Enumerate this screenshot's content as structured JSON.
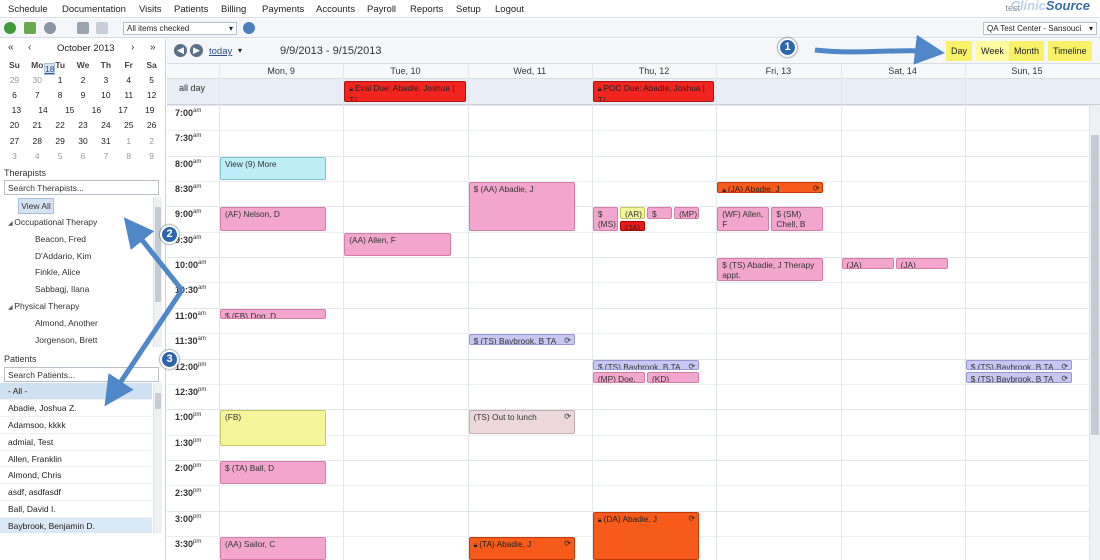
{
  "menu": [
    "Schedule",
    "Documentation",
    "Visits",
    "Patients",
    "Billing",
    "Payments",
    "Accounts",
    "Payroll",
    "Reports",
    "Setup",
    "Logout"
  ],
  "brand": {
    "user": "test",
    "logo_a": "Clinic",
    "logo_b": "Source"
  },
  "toolbar": {
    "filter_select": "All items checked",
    "center_select": "QA Test Center - Sansouci"
  },
  "mini_calendar": {
    "title": "October 2013",
    "nav": [
      "«",
      "‹",
      "›",
      "»"
    ],
    "weekdays": [
      "Su",
      "Mo",
      "Tu",
      "We",
      "Th",
      "Fr",
      "Sa"
    ],
    "weeks": [
      [
        "29",
        "30",
        "1",
        "2",
        "3",
        "4",
        "5"
      ],
      [
        "6",
        "7",
        "8",
        "9",
        "10",
        "11",
        "12"
      ],
      [
        "13",
        "14",
        "15",
        "16",
        "17",
        "18",
        "19"
      ],
      [
        "20",
        "21",
        "22",
        "23",
        "24",
        "25",
        "26"
      ],
      [
        "27",
        "28",
        "29",
        "30",
        "31",
        "1",
        "2"
      ],
      [
        "3",
        "4",
        "5",
        "6",
        "7",
        "8",
        "9"
      ]
    ]
  },
  "therapists": {
    "label": "Therapists",
    "search_placeholder": "Search Therapists...",
    "view_all": "View All",
    "groups": [
      {
        "name": "Occupational Therapy",
        "members": [
          "Beacon, Fred",
          "D'Addario, Kim",
          "Finkle, Alice",
          "Sabbagj, Ilana"
        ]
      },
      {
        "name": "Physical Therapy",
        "members": [
          "Almond, Another",
          "Jorgenson, Brett"
        ]
      }
    ]
  },
  "patients": {
    "label": "Patients",
    "search_placeholder": "Search Patients...",
    "items": [
      "- All -",
      "Abadie, Joshua Z.",
      "Adamsoo, kkkk",
      "admial, Test",
      "Allen, Franklin",
      "Almond, Chris",
      "asdf, asdfasdf",
      "Ball, David I.",
      "Baybrook, Benjamin D."
    ]
  },
  "calendar": {
    "today_label": "today",
    "range": "9/9/2013 - 9/15/2013",
    "views": [
      "Day",
      "Week",
      "Month",
      "Timeline"
    ],
    "days": [
      "Mon, 9",
      "Tue, 10",
      "Wed, 11",
      "Thu, 12",
      "Fri, 13",
      "Sat, 14",
      "Sun, 15"
    ],
    "all_day_label": "all day",
    "times": [
      {
        "h": "7:00",
        "ap": "am"
      },
      {
        "h": "7:30",
        "ap": "am"
      },
      {
        "h": "8:00",
        "ap": "am"
      },
      {
        "h": "8:30",
        "ap": "am"
      },
      {
        "h": "9:00",
        "ap": "am"
      },
      {
        "h": "9:30",
        "ap": "am"
      },
      {
        "h": "10:00",
        "ap": "am"
      },
      {
        "h": "10:30",
        "ap": "am"
      },
      {
        "h": "11:00",
        "ap": "am"
      },
      {
        "h": "11:30",
        "ap": "am"
      },
      {
        "h": "12:00",
        "ap": "pm"
      },
      {
        "h": "12:30",
        "ap": "pm"
      },
      {
        "h": "1:00",
        "ap": "pm"
      },
      {
        "h": "1:30",
        "ap": "pm"
      },
      {
        "h": "2:00",
        "ap": "pm"
      },
      {
        "h": "2:30",
        "ap": "pm"
      },
      {
        "h": "3:00",
        "ap": "pm"
      },
      {
        "h": "3:30",
        "ap": "pm"
      }
    ],
    "all_day_events": [
      {
        "day": 1,
        "text": "Eval Due: Abadie, Joshua | T/",
        "color": "red"
      },
      {
        "day": 3,
        "text": "POC Due: Abadie, Joshua | T/",
        "color": "red"
      }
    ],
    "events": [
      {
        "day": 0,
        "start": 2,
        "end": 3,
        "text": "View (9) More",
        "color": "cyan"
      },
      {
        "day": 0,
        "start": 4,
        "end": 5,
        "text": "(AF) Nelson, D",
        "color": "pink"
      },
      {
        "day": 0,
        "start": 8,
        "end": 8.5,
        "text": "$ (FB) Dog, D",
        "color": "pink"
      },
      {
        "day": 0,
        "start": 12,
        "end": 13.5,
        "text": "(FB)",
        "color": "yellow"
      },
      {
        "day": 0,
        "start": 14,
        "end": 15,
        "text": "$ (TA) Ball, D",
        "color": "pink"
      },
      {
        "day": 0,
        "start": 17,
        "end": 18,
        "text": "(AA) Sailor, C",
        "color": "pink"
      },
      {
        "day": 1,
        "start": 5,
        "end": 6,
        "text": "(AA) Allen, F",
        "color": "pink"
      },
      {
        "day": 2,
        "start": 3,
        "end": 5,
        "text": "$ (AA) Abadie, J",
        "color": "pink"
      },
      {
        "day": 2,
        "start": 9,
        "end": 9.5,
        "text": "$ (TS) Baybrook, B TA",
        "color": "lav",
        "rec": true
      },
      {
        "day": 2,
        "start": 12,
        "end": 13,
        "text": "(TS) Out to lunch",
        "color": "tan",
        "rec": true
      },
      {
        "day": 2,
        "start": 17,
        "end": 18,
        "text": "(TA) Abadie, J",
        "color": "orange",
        "lock": true,
        "rec": true
      },
      {
        "day": 3,
        "start": 4,
        "end": 5,
        "text": "$ (MS) Ball, D",
        "color": "pink",
        "col": 0,
        "cols": 4
      },
      {
        "day": 3,
        "start": 4,
        "end": 4.55,
        "text": "(AR) Colon",
        "color": "yellow",
        "col": 1,
        "cols": 4
      },
      {
        "day": 3,
        "start": 4,
        "end": 4.55,
        "text": "$ (KB)",
        "color": "pink",
        "col": 2,
        "cols": 4
      },
      {
        "day": 3,
        "start": 4,
        "end": 4.55,
        "text": "(MP) Britte",
        "color": "pink",
        "col": 3,
        "cols": 4
      },
      {
        "day": 3,
        "start": 4.55,
        "end": 5,
        "text": "(JA) Allen",
        "color": "dred",
        "col": 1,
        "cols": 4
      },
      {
        "day": 3,
        "start": 10,
        "end": 10.5,
        "text": "$ (TS) Baybrook, B TA",
        "color": "lav",
        "rec": true
      },
      {
        "day": 3,
        "start": 10.5,
        "end": 11,
        "text": "(MP) Doe, J",
        "color": "pink",
        "col": 0,
        "cols": 2
      },
      {
        "day": 3,
        "start": 10.5,
        "end": 11,
        "text": "(KD) Byrne, D",
        "color": "pink",
        "col": 1,
        "cols": 2
      },
      {
        "day": 3,
        "start": 16,
        "end": 18,
        "text": "(DA) Abadie, J",
        "color": "orange",
        "lock": true,
        "rec": true
      },
      {
        "day": 4,
        "start": 3,
        "end": 3.5,
        "text": "(JA) Abadie, J",
        "color": "orange",
        "lock": true,
        "rec": true
      },
      {
        "day": 4,
        "start": 4,
        "end": 5,
        "text": "(WF) Allen, F",
        "color": "pink",
        "col": 0,
        "cols": 2
      },
      {
        "day": 4,
        "start": 4,
        "end": 5,
        "text": "$ (SM) Chell, B",
        "color": "pink",
        "col": 1,
        "cols": 2
      },
      {
        "day": 4,
        "start": 6,
        "end": 7,
        "text": "$ (TS) Abadie, J Therapy appt.",
        "color": "pink"
      },
      {
        "day": 5,
        "start": 6,
        "end": 6.5,
        "text": "(JA) admial, T",
        "color": "pink",
        "col": 0,
        "cols": 2
      },
      {
        "day": 5,
        "start": 6,
        "end": 6.5,
        "text": "(JA) admial, T test recur",
        "color": "pink",
        "col": 1,
        "cols": 2
      },
      {
        "day": 6,
        "start": 10,
        "end": 10.5,
        "text": "$ (TS) Baybrook, B TA",
        "color": "lav",
        "rec": true
      },
      {
        "day": 6,
        "start": 10.5,
        "end": 11,
        "text": "$ (TS) Baybrook, B TA",
        "color": "lav",
        "rec": true
      }
    ]
  },
  "annotations": [
    "1",
    "2",
    "3"
  ],
  "colors": {
    "highlight": "#f7f269",
    "badge": "#2d66ad",
    "arrow": "#4f87c8"
  }
}
